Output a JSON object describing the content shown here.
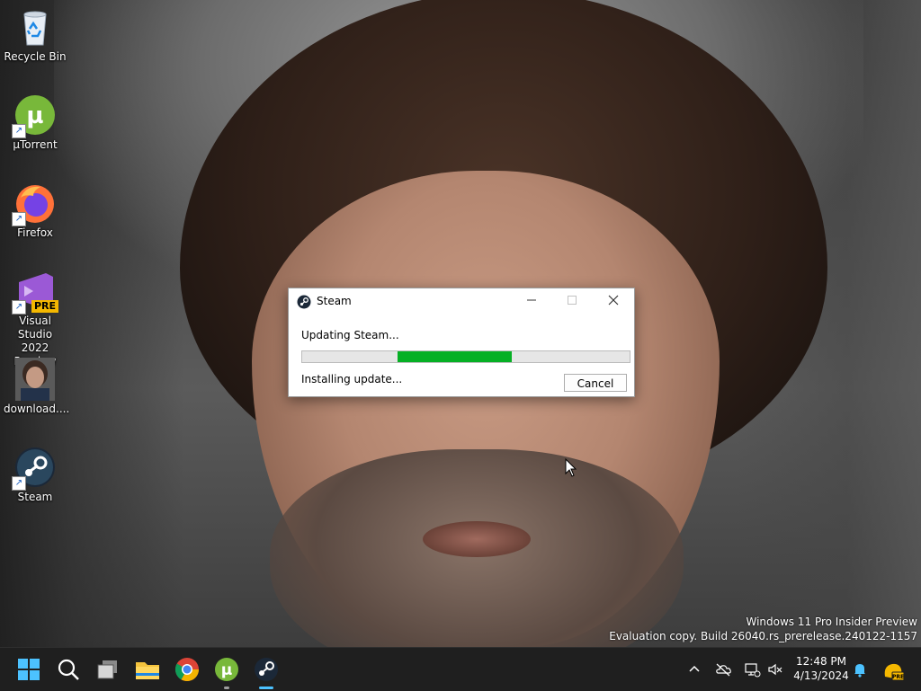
{
  "desktop": {
    "icons": [
      {
        "label": "Recycle Bin",
        "icon": "recycle-bin-icon"
      },
      {
        "label": "µTorrent",
        "icon": "utorrent-icon"
      },
      {
        "label": "Firefox",
        "icon": "firefox-icon"
      },
      {
        "label": "Visual Studio\n2022 Preview",
        "icon": "visual-studio-icon",
        "badge": "PRE"
      },
      {
        "label": "download....",
        "icon": "image-file-icon"
      },
      {
        "label": "Steam",
        "icon": "steam-icon"
      }
    ]
  },
  "watermark": {
    "line1": "Windows 11 Pro Insider Preview",
    "line2": "Evaluation copy. Build 26040.rs_prerelease.240122-1157"
  },
  "steam_dialog": {
    "title": "Steam",
    "heading": "Updating Steam...",
    "status": "Installing update...",
    "cancel_label": "Cancel",
    "progress": {
      "start_fraction": 0.29,
      "end_fraction": 0.64,
      "color": "#06b025"
    }
  },
  "taskbar": {
    "apps": [
      "start-icon",
      "search-icon",
      "task-view-icon",
      "file-explorer-icon",
      "chrome-icon",
      "utorrent-icon",
      "steam-icon"
    ],
    "clock": {
      "time": "12:48 PM",
      "date": "4/13/2024"
    },
    "tray": [
      "chevron-up-icon",
      "onedrive-icon",
      "network-icon",
      "volume-muted-icon",
      "notification-bell-icon",
      "copilot-icon"
    ]
  }
}
